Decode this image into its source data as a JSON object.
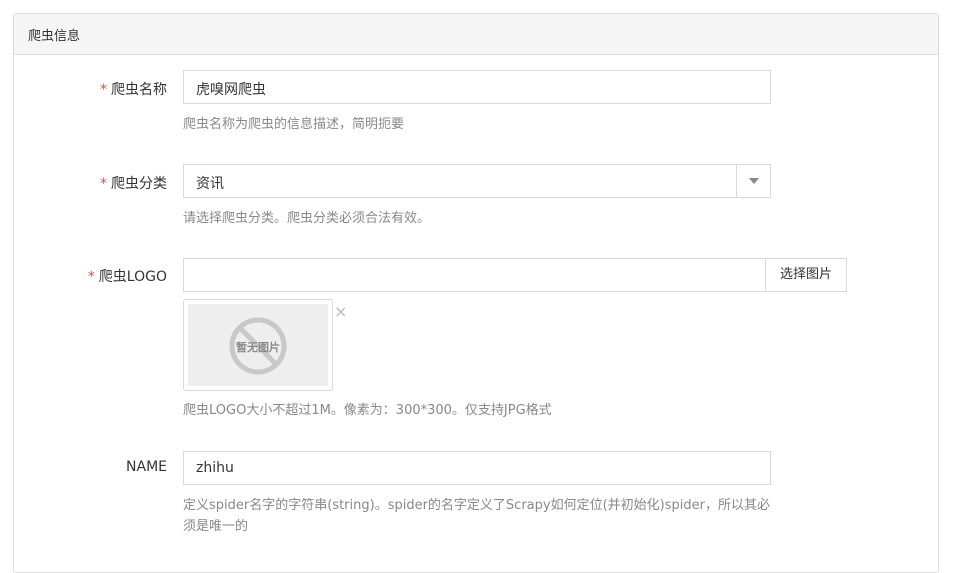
{
  "panel": {
    "title": "爬虫信息"
  },
  "fields": {
    "name": {
      "required_mark": "*",
      "label": "爬虫名称",
      "value": "虎嗅网爬虫",
      "help": "爬虫名称为爬虫的信息描述，简明扼要"
    },
    "category": {
      "required_mark": "*",
      "label": "爬虫分类",
      "selected": "资讯",
      "help": "请选择爬虫分类。爬虫分类必须合法有效。"
    },
    "logo": {
      "required_mark": "*",
      "label": "爬虫LOGO",
      "value": "",
      "button_label": "选择图片",
      "placeholder_text": "暂无图片",
      "remove_symbol": "×",
      "help": "爬虫LOGO大小不超过1M。像素为：300*300。仅支持JPG格式"
    },
    "spider_name": {
      "label": "NAME",
      "value": "zhihu",
      "help": "定义spider名字的字符串(string)。spider的名字定义了Scrapy如何定位(并初始化)spider，所以其必须是唯一的"
    }
  },
  "icons": {
    "select_caret": "caret-down-icon",
    "no_image": "no-image-icon",
    "remove": "close-icon"
  },
  "colors": {
    "required": "#e74c3c",
    "help_text": "#888888",
    "border": "#d9d9d9",
    "heading_bg": "#f5f5f5"
  }
}
